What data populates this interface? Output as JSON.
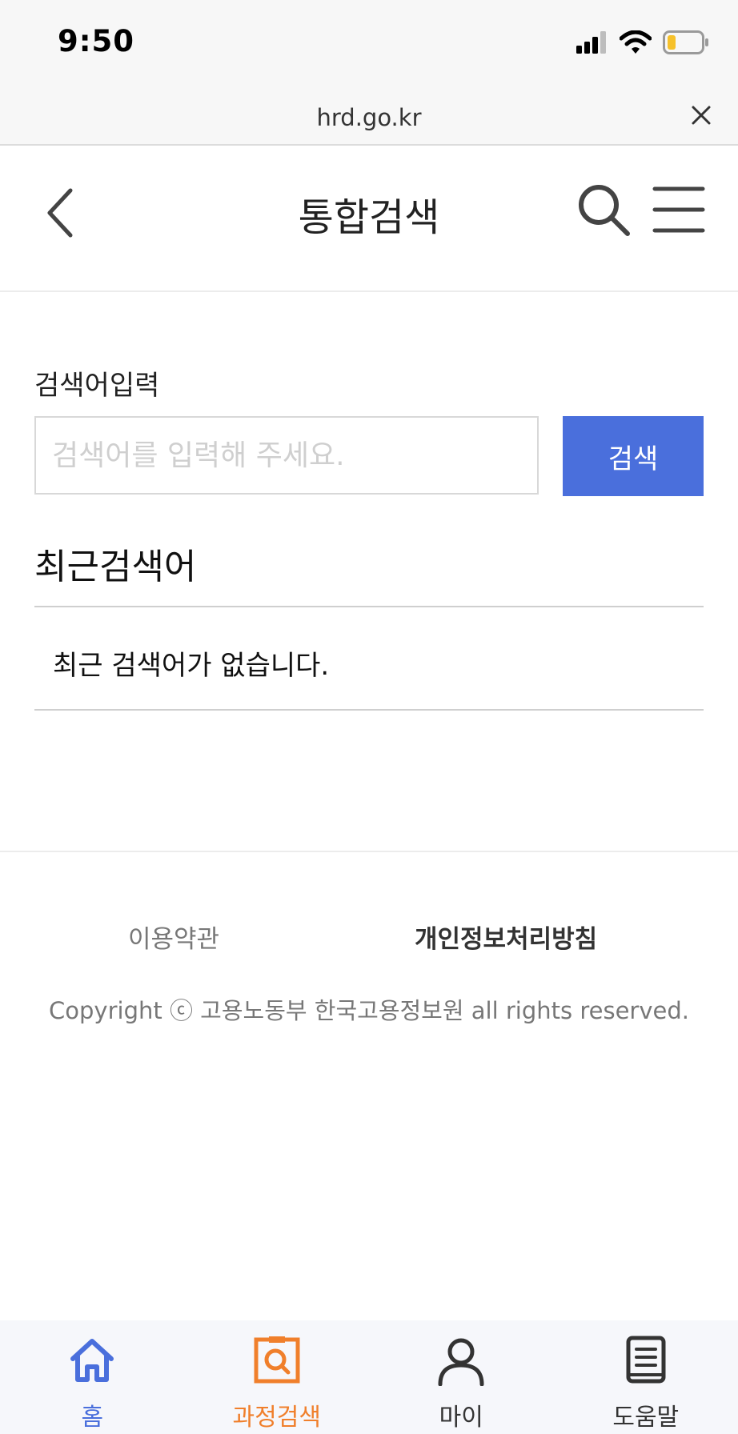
{
  "status_bar": {
    "time": "9:50"
  },
  "browser": {
    "url": "hrd.go.kr"
  },
  "header": {
    "title": "통합검색"
  },
  "search": {
    "label": "검색어입력",
    "placeholder": "검색어를 입력해 주세요.",
    "button_label": "검색"
  },
  "recent": {
    "title": "최근검색어",
    "empty_message": "최근 검색어가 없습니다."
  },
  "footer": {
    "terms": "이용약관",
    "privacy": "개인정보처리방침",
    "copyright": "Copyright ⓒ 고용노동부 한국고용정보원 all rights reserved."
  },
  "tabs": [
    {
      "label": "홈",
      "icon": "home-icon",
      "color": "#4a6fdc"
    },
    {
      "label": "과정검색",
      "icon": "course-search-icon",
      "color": "#f07f2b"
    },
    {
      "label": "마이",
      "icon": "person-icon",
      "color": "#333333"
    },
    {
      "label": "도움말",
      "icon": "book-icon",
      "color": "#333333"
    }
  ],
  "colors": {
    "accent": "#4a6fdc",
    "active_tab": "#f07f2b"
  }
}
